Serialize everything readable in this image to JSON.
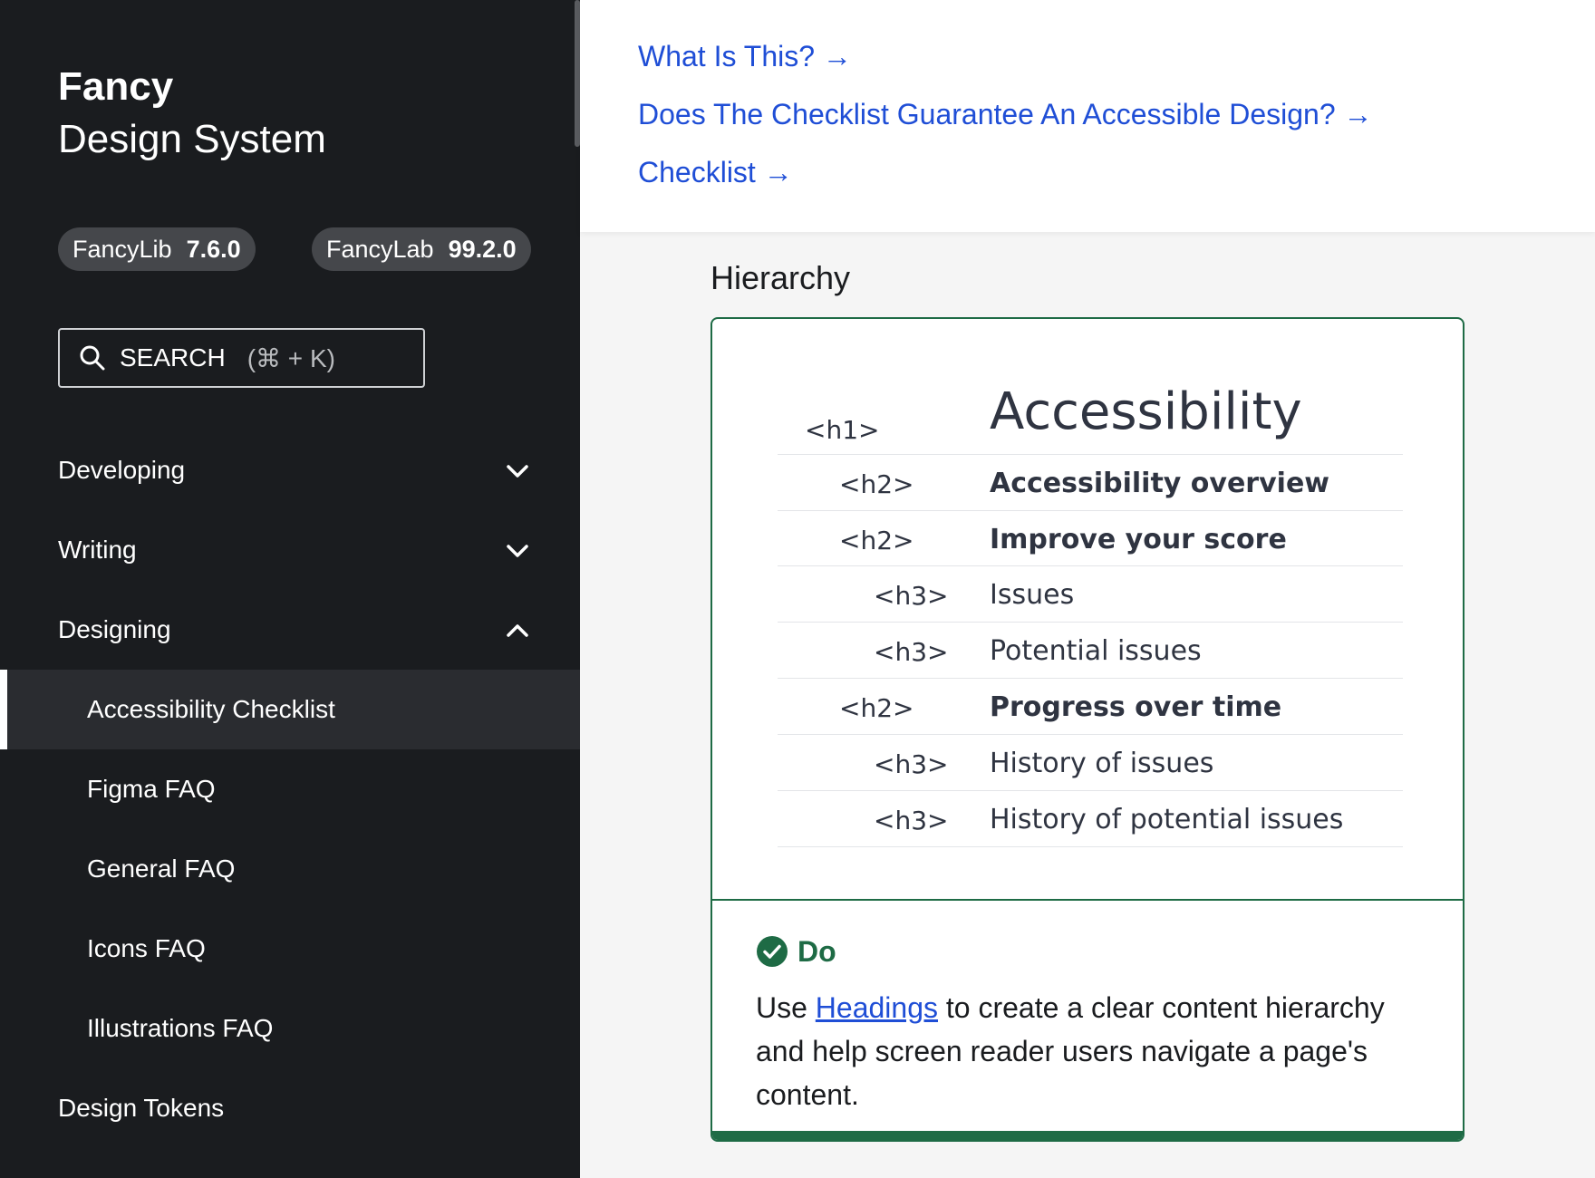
{
  "brand": {
    "name": "Fancy",
    "subtitle": "Design System"
  },
  "versions": [
    {
      "name": "FancyLib",
      "version": "7.6.0"
    },
    {
      "name": "FancyLab",
      "version": "99.2.0"
    }
  ],
  "search": {
    "label": "SEARCH",
    "hint": "(⌘ + K)"
  },
  "nav": {
    "developing": "Developing",
    "writing": "Writing",
    "designing": "Designing",
    "designing_items": [
      "Accessibility Checklist",
      "Figma FAQ",
      "General FAQ",
      "Icons FAQ",
      "Illustrations FAQ"
    ],
    "design_tokens": "Design Tokens"
  },
  "toc": {
    "links": [
      "What Is This? →",
      "Does The Checklist Guarantee An Accessible Design? →",
      "Checklist →"
    ]
  },
  "section": {
    "title": "Hierarchy"
  },
  "hierarchy": [
    {
      "tag": "<h1>",
      "text": "Accessibility"
    },
    {
      "tag": "<h2>",
      "text": "Accessibility overview"
    },
    {
      "tag": "<h2>",
      "text": "Improve your score"
    },
    {
      "tag": "<h3>",
      "text": "Issues"
    },
    {
      "tag": "<h3>",
      "text": "Potential issues"
    },
    {
      "tag": "<h2>",
      "text": "Progress over time"
    },
    {
      "tag": "<h3>",
      "text": "History of issues"
    },
    {
      "tag": "<h3>",
      "text": "History of potential issues"
    }
  ],
  "do": {
    "label": "Do",
    "text_before": "Use ",
    "link": "Headings",
    "text_after": " to create a clear content hierarchy and help screen reader users navigate a page's content."
  },
  "colors": {
    "sidebar_bg": "#1a1c1f",
    "link": "#1f4ed6",
    "success": "#1e6b45"
  },
  "icons": {
    "search": "search-icon",
    "chevron_down": "chevron-down-icon",
    "chevron_up": "chevron-up-icon",
    "check": "check-circle-icon"
  }
}
